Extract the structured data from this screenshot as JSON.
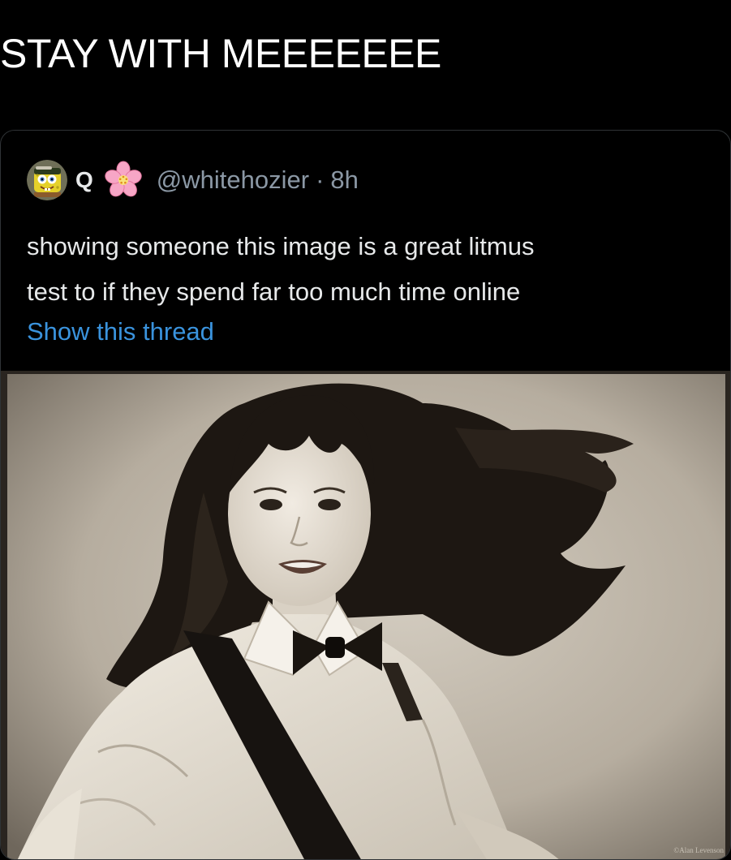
{
  "post": {
    "title": "STAY WITH MEEEEEEE"
  },
  "quoted_tweet": {
    "display_name": "Q",
    "avatar_icon": "spongebob-avatar-icon",
    "flower_emoji": "cherry-blossom-icon",
    "handle": "@whitehozier",
    "separator": "·",
    "timestamp": "8h",
    "text_lines": [
      "showing someone this image is a great litmus",
      "test to if they spend far too much time online"
    ],
    "show_thread_label": "Show this thread",
    "media": {
      "watermark": "©Alan Levenson",
      "colors": {
        "paper": "#bdb5a8",
        "hair": "#1d1712",
        "shirt": "#ece6da",
        "suspender": "#171310"
      }
    }
  },
  "colors": {
    "background": "#000000",
    "text": "#e7e9ea",
    "muted": "#8b98a5",
    "link": "#3a93dd",
    "card_border": "#2f3336"
  }
}
